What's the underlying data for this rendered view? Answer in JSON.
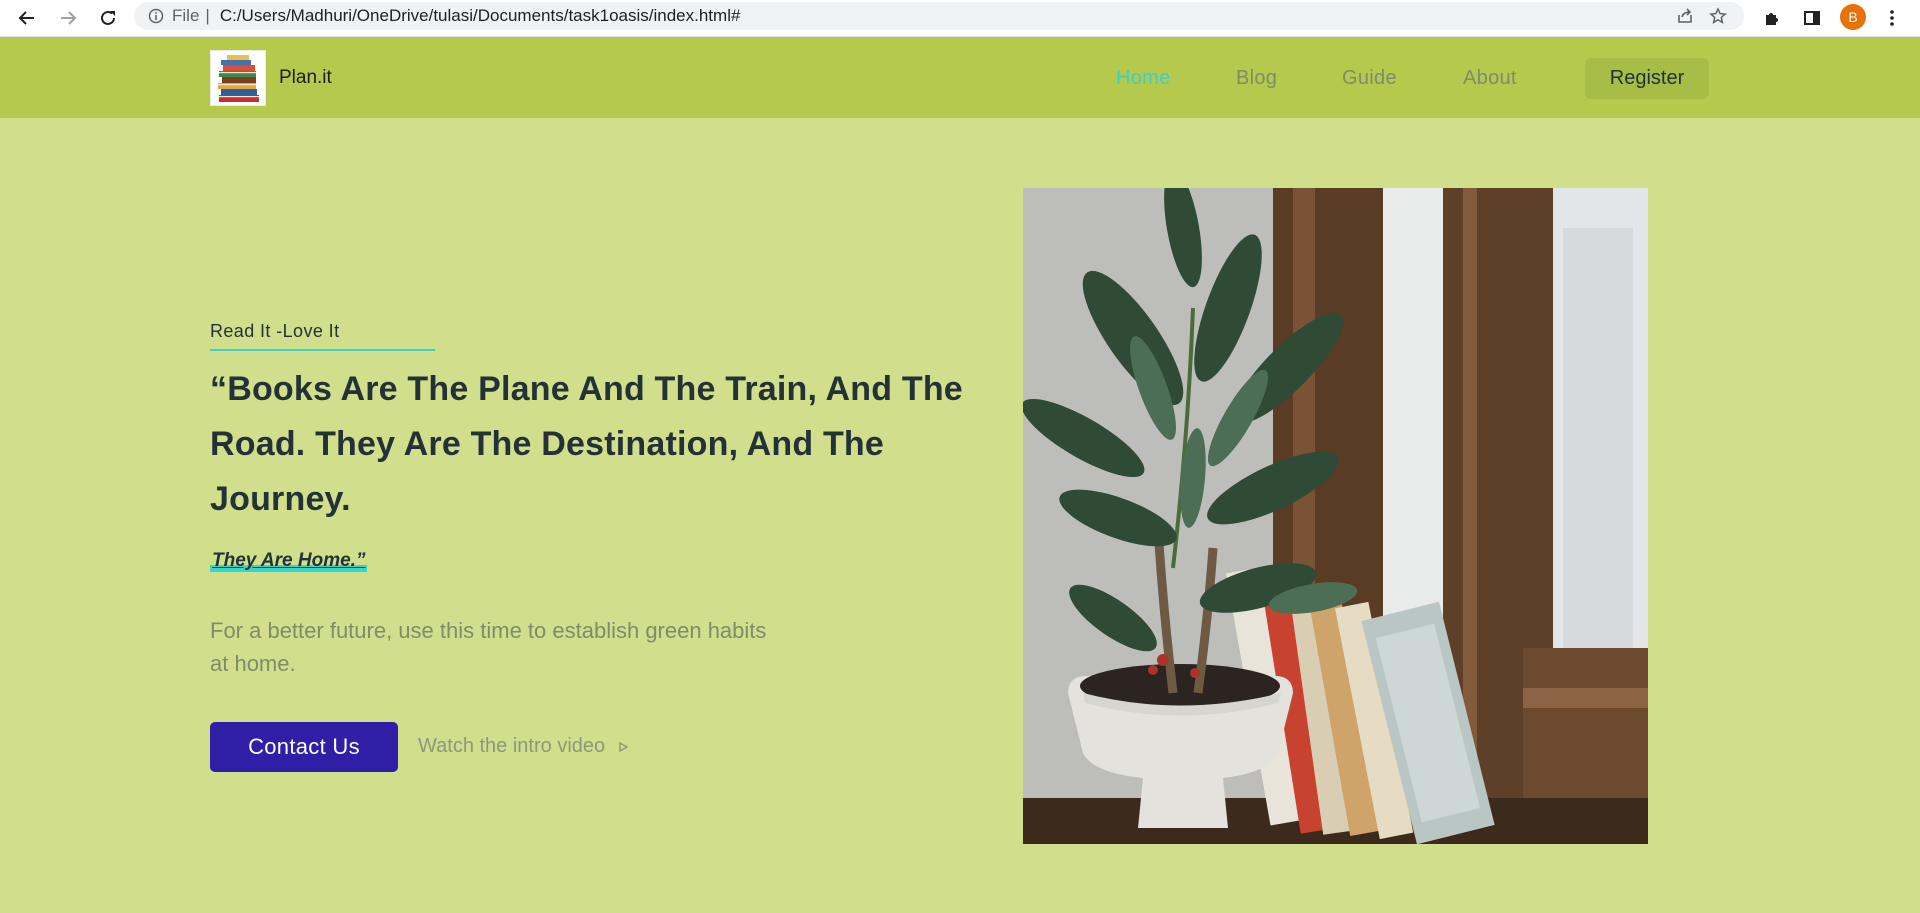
{
  "browser": {
    "url_scheme": "File",
    "url": "C:/Users/Madhuri/OneDrive/tulasi/Documents/task1oasis/index.html#",
    "profile_initial": "B",
    "icons": [
      "back-icon",
      "forward-icon",
      "reload-icon",
      "info-icon",
      "share-icon",
      "star-icon",
      "puzzle-icon",
      "sidebar-icon",
      "kebab-menu-icon"
    ]
  },
  "header": {
    "brand": "Plan.it",
    "nav": [
      {
        "label": "Home",
        "active": true
      },
      {
        "label": "Blog",
        "active": false
      },
      {
        "label": "Guide",
        "active": false
      },
      {
        "label": "About",
        "active": false
      }
    ],
    "register_label": "Register"
  },
  "hero": {
    "tagline": "Read It -Love It",
    "quote": "“Books Are The Plane And The Train, And The Road. They Are The Destination, And The Journey.",
    "quote_end": "They Are Home.”",
    "subtext": "For a better future, use this time to establish green habits at home.",
    "contact_label": "Contact Us",
    "watch_label": "Watch the intro video"
  },
  "colors": {
    "page_bg": "#d1df8c",
    "header_bg": "#b5ca4d",
    "accent_teal": "#3fd0c2",
    "button_primary": "#2e1fa6",
    "heading_text": "#243238"
  }
}
